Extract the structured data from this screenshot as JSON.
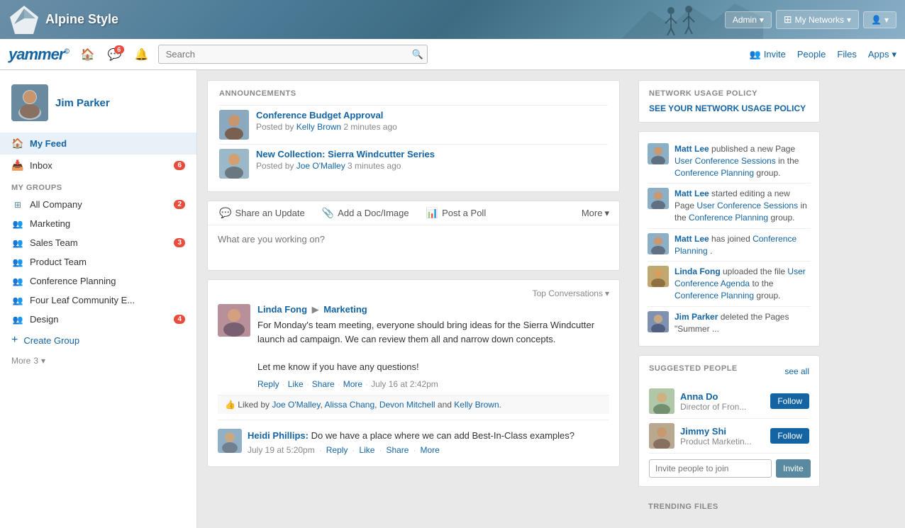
{
  "banner": {
    "logo_line1": "Alpine Style",
    "admin_label": "Admin",
    "networks_label": "My Networks",
    "user_icon_label": "User"
  },
  "navbar": {
    "logo": "yammer",
    "logo_suffix": "©",
    "search_placeholder": "Search",
    "badge_count": "6",
    "invite_label": "Invite",
    "people_label": "People",
    "files_label": "Files",
    "apps_label": "Apps"
  },
  "sidebar": {
    "username": "Jim Parker",
    "nav_items": [
      {
        "id": "my-feed",
        "label": "My Feed",
        "icon": "🏠",
        "active": true
      },
      {
        "id": "inbox",
        "label": "Inbox",
        "badge": "6",
        "icon": "📥",
        "active": false
      }
    ],
    "groups_title": "MY GROUPS",
    "groups": [
      {
        "id": "all-company",
        "label": "All Company",
        "badge": "2"
      },
      {
        "id": "marketing",
        "label": "Marketing",
        "badge": ""
      },
      {
        "id": "sales-team",
        "label": "Sales Team",
        "badge": "3"
      },
      {
        "id": "product-team",
        "label": "Product Team",
        "badge": ""
      },
      {
        "id": "conference-planning",
        "label": "Conference Planning",
        "badge": ""
      },
      {
        "id": "four-leaf",
        "label": "Four Leaf Community E...",
        "badge": ""
      },
      {
        "id": "design",
        "label": "Design",
        "badge": "4"
      }
    ],
    "create_group_label": "Create Group",
    "more_label": "More",
    "more_count": "3"
  },
  "announcements": {
    "title": "ANNOUNCEMENTS",
    "items": [
      {
        "title": "Conference Budget Approval",
        "meta_prefix": "Posted by",
        "author": "Kelly Brown",
        "time": "2 minutes ago"
      },
      {
        "title": "New Collection: Sierra Windcutter Series",
        "meta_prefix": "Posted by",
        "author": "Joe O'Malley",
        "time": "3 minutes ago"
      }
    ]
  },
  "post_box": {
    "action_share": "Share an Update",
    "action_doc": "Add a Doc/Image",
    "action_poll": "Post a Poll",
    "action_more": "More",
    "placeholder": "What are you working on?"
  },
  "feed": {
    "top_conversations_label": "Top Conversations",
    "post": {
      "poster": "Linda Fong",
      "arrow": "▶",
      "group": "Marketing",
      "message_lines": [
        "For Monday's team meeting, everyone should bring ideas for the Sierra",
        "Windcutter launch ad campaign. We can review them all and narrow down",
        "concepts.",
        "",
        "Let me know if you have any questions!"
      ],
      "message": "For Monday's team meeting, everyone should bring ideas for the Sierra Windcutter launch ad campaign. We can review them all and narrow down concepts.\n\nLet me know if you have any questions!",
      "reply_label": "Reply",
      "like_label": "Like",
      "share_label": "Share",
      "more_label": "More",
      "timestamp": "July 16 at 2:42pm",
      "liked_by_prefix": "Liked by",
      "liked_by": [
        "Joe O'Malley",
        "Alissa Chang",
        "Devon Mitchell",
        "Kelly Brown"
      ],
      "liked_by_and": "and",
      "reply": {
        "author": "Heidi Phillips:",
        "text": "Do we have a place where we can add Best-In-Class examples?",
        "timestamp": "July 19 at 5:20pm",
        "reply_label": "Reply",
        "like_label": "Like",
        "share_label": "Share",
        "more_label": "More"
      }
    }
  },
  "right_panel": {
    "network_policy": {
      "title": "NETWORK USAGE POLICY",
      "link_label": "SEE YOUR NETWORK USAGE POLICY"
    },
    "activity": {
      "items": [
        {
          "person": "Matt Lee",
          "action": "published a new Page",
          "page": "User Conference Sessions",
          "prep": "in the",
          "group": "Conference Planning",
          "suffix": "group."
        },
        {
          "person": "Matt Lee",
          "action": "started editing a new Page",
          "page": "User Conference Sessions",
          "prep": "in the",
          "group": "Conference Planning",
          "suffix": "group."
        },
        {
          "person": "Matt Lee",
          "action": "has joined",
          "group": "Conference Planning",
          "suffix": "."
        },
        {
          "person": "Linda Fong",
          "action": "uploaded the file",
          "page": "User Conference Agenda",
          "prep": "to the",
          "group": "Conference Planning",
          "suffix": "group."
        },
        {
          "person": "Jim Parker",
          "action": "deleted the Pages \"Summer ...\""
        }
      ]
    },
    "suggested_people": {
      "title": "SUGGESTED PEOPLE",
      "see_all": "see all",
      "people": [
        {
          "name": "Anna Do",
          "title": "Director of Fron..."
        },
        {
          "name": "Jimmy Shi",
          "title": "Product Marketin..."
        }
      ],
      "follow_label": "Follow",
      "invite_placeholder": "Invite people to join",
      "invite_btn": "Invite"
    },
    "trending_files": {
      "title": "TRENDING FILES"
    }
  }
}
